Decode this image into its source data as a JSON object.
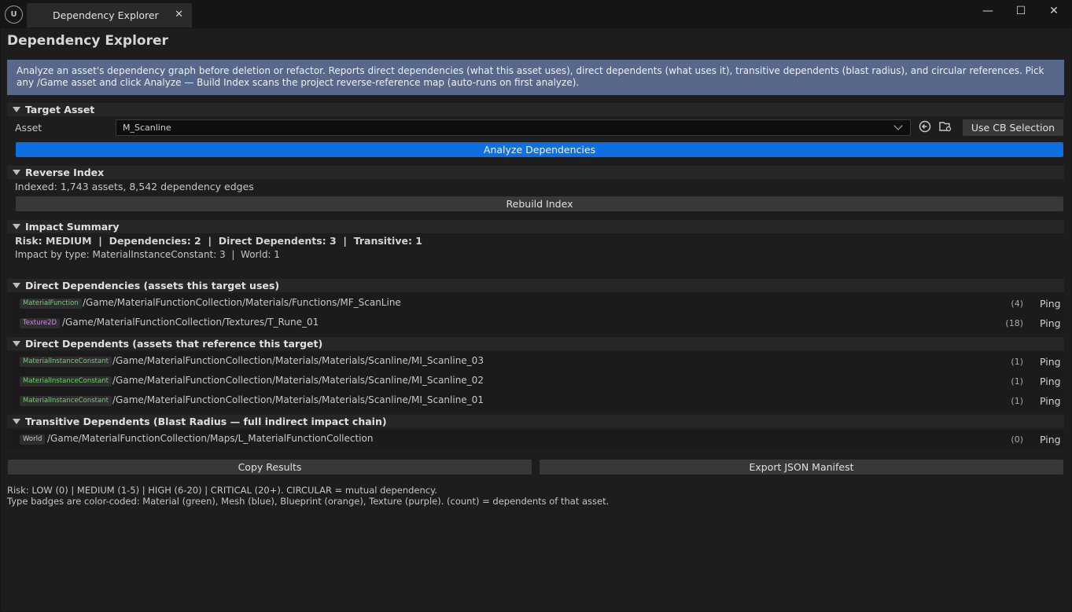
{
  "window": {
    "logo": "U",
    "tab_title": "Dependency Explorer",
    "tab_close": "✕",
    "minimize": "—",
    "maximize": "☐",
    "close": "✕"
  },
  "page": {
    "title": "Dependency Explorer",
    "info": "Analyze an asset's dependency graph before deletion or refactor. Reports direct dependencies (what this asset uses), direct dependents (what uses it), transitive dependents (blast radius), and circular references. Pick any /Game asset and click Analyze — Build Index scans the project reverse-reference map (auto-runs on first analyze).",
    "info_bg": "#57688a"
  },
  "target": {
    "section_title": "Target Asset",
    "asset_label": "Asset",
    "asset_value": "M_Scanline",
    "browse_icon": "arrow-left-circle",
    "folder_icon": "folder-search",
    "use_cb_label": "Use CB Selection",
    "analyze_label": "Analyze Dependencies",
    "analyze_color": "#0e6fe0"
  },
  "reverse_index": {
    "section_title": "Reverse Index",
    "status": "Indexed: 1,743 assets, 8,542 dependency edges",
    "rebuild_label": "Rebuild Index"
  },
  "impact": {
    "section_title": "Impact Summary",
    "summary": "Risk: MEDIUM  |  Dependencies: 2  |  Direct Dependents: 3  |  Transitive: 1",
    "by_type": "Impact by type: MaterialInstanceConstant: 3  |  World: 1"
  },
  "direct_dependencies": {
    "section_title": "Direct Dependencies (assets this target uses)",
    "rows": [
      {
        "type": "MaterialFunction",
        "path": "/Game/MaterialFunctionCollection/Materials/Functions/MF_ScanLine",
        "count": "(4)",
        "ping": "Ping"
      },
      {
        "type": "Texture2D",
        "path": "/Game/MaterialFunctionCollection/Textures/T_Rune_01",
        "count": "(18)",
        "ping": "Ping"
      }
    ]
  },
  "direct_dependents": {
    "section_title": "Direct Dependents (assets that reference this target)",
    "rows": [
      {
        "type": "MaterialInstanceConstant",
        "path": "/Game/MaterialFunctionCollection/Materials/Materials/Scanline/MI_Scanline_03",
        "count": "(1)",
        "ping": "Ping"
      },
      {
        "type": "MaterialInstanceConstant",
        "path": "/Game/MaterialFunctionCollection/Materials/Materials/Scanline/MI_Scanline_02",
        "count": "(1)",
        "ping": "Ping"
      },
      {
        "type": "MaterialInstanceConstant",
        "path": "/Game/MaterialFunctionCollection/Materials/Materials/Scanline/MI_Scanline_01",
        "count": "(1)",
        "ping": "Ping"
      }
    ]
  },
  "transitive": {
    "section_title": "Transitive Dependents (Blast Radius — full indirect impact chain)",
    "rows": [
      {
        "type": "World",
        "path": "/Game/MaterialFunctionCollection/Maps/L_MaterialFunctionCollection",
        "count": "(0)",
        "ping": "Ping"
      }
    ]
  },
  "actions": {
    "copy_label": "Copy Results",
    "export_label": "Export JSON Manifest"
  },
  "footer": {
    "line1": "Risk: LOW (0) | MEDIUM (1-5) | HIGH (6-20) | CRITICAL (20+). CIRCULAR = mutual dependency.",
    "line2": "Type badges are color-coded: Material (green), Mesh (blue), Blueprint (orange), Texture (purple). (count) = dependents of that asset."
  },
  "badge_colors": {
    "material": "#6fcf6f",
    "texture": "#c98fe0",
    "world": "#c8c8c8"
  }
}
